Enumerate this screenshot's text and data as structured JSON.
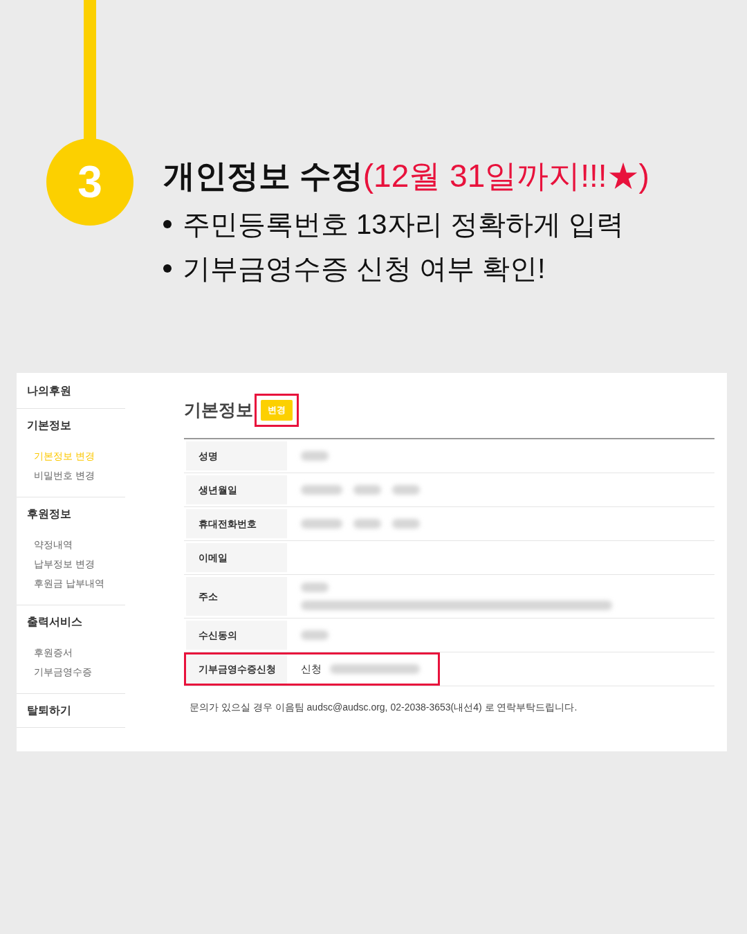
{
  "step": {
    "number": "3",
    "title": "개인정보 수정",
    "title_note": "(12월 31일까지!!!★)",
    "bullets": [
      "주민등록번호 13자리 정확하게 입력",
      "기부금영수증 신청 여부 확인!"
    ]
  },
  "sidebar": {
    "title": "나의후원",
    "groups": [
      {
        "label": "기본정보",
        "items": [
          {
            "label": "기본정보 변경",
            "selected": true
          },
          {
            "label": "비밀번호 변경",
            "selected": false
          }
        ]
      },
      {
        "label": "후원정보",
        "items": [
          {
            "label": "약정내역",
            "selected": false
          },
          {
            "label": "납부정보 변경",
            "selected": false
          },
          {
            "label": "후원금 납부내역",
            "selected": false
          }
        ]
      },
      {
        "label": "출력서비스",
        "items": [
          {
            "label": "후원증서",
            "selected": false
          },
          {
            "label": "기부금영수증",
            "selected": false
          }
        ]
      },
      {
        "label": "탈퇴하기"
      }
    ]
  },
  "main": {
    "heading": "기본정보",
    "edit_button": {
      "label": "변경",
      "highlighted": true
    },
    "rows": [
      {
        "label": "성명",
        "kind": "redacted_short",
        "highlighted": false
      },
      {
        "label": "생년월일",
        "kind": "redacted_long",
        "highlighted": false
      },
      {
        "label": "휴대전화번호",
        "kind": "redacted_long",
        "highlighted": false
      },
      {
        "label": "이메일",
        "kind": "empty",
        "highlighted": false
      },
      {
        "label": "주소",
        "kind": "redacted_two_line",
        "highlighted": false
      },
      {
        "label": "수신동의",
        "kind": "redacted_short",
        "highlighted": false
      },
      {
        "label": "기부금영수증신청",
        "kind": "text_redacted",
        "value": "신청",
        "highlighted": true
      }
    ],
    "note": "문의가 있으실 경우 이음팀 audsc@audsc.org, 02-2038-3653(내선4) 로 연락부탁드립니다."
  }
}
